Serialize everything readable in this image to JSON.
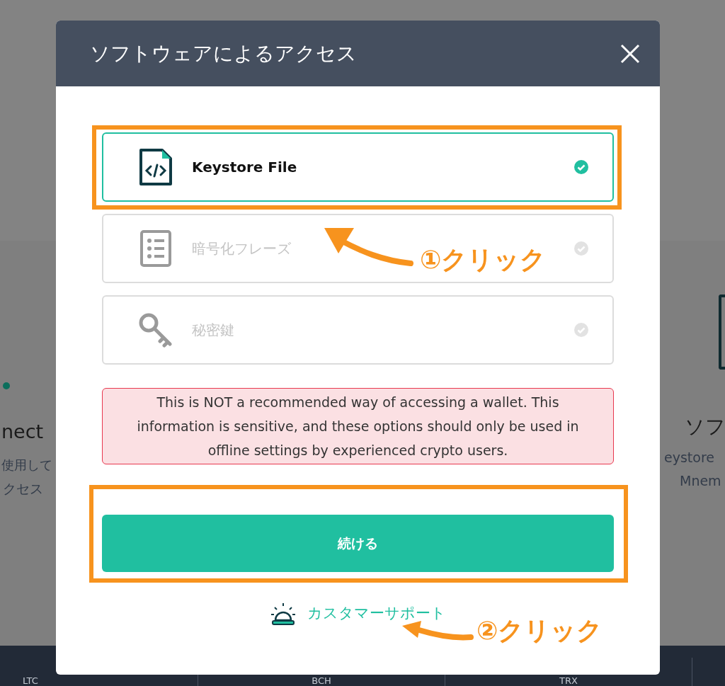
{
  "background": {
    "left_card": [
      "nect",
      "使用して",
      "クセス"
    ],
    "right_card": [
      "ソフ",
      "eystore",
      "Mnem"
    ],
    "footer_columns": [
      "LTC",
      "BCH",
      "TRX"
    ]
  },
  "modal": {
    "title": "ソフトウェアによるアクセス",
    "options": [
      {
        "kind": "file",
        "label": "Keystore File",
        "selected": true,
        "highlighted": true
      },
      {
        "kind": "list",
        "label": "暗号化フレーズ",
        "selected": false,
        "highlighted": false
      },
      {
        "kind": "key",
        "label": "秘密鍵",
        "selected": false,
        "highlighted": false
      }
    ],
    "warning": "This is NOT a recommended way of accessing a wallet. This information is sensitive, and these options should only be used in offline settings by experienced crypto users.",
    "continue_button": {
      "label": "続ける",
      "highlighted": true
    },
    "support_link": "カスタマーサポート"
  },
  "annotations": [
    {
      "label": "①クリック"
    },
    {
      "label": "②クリック"
    }
  ]
}
